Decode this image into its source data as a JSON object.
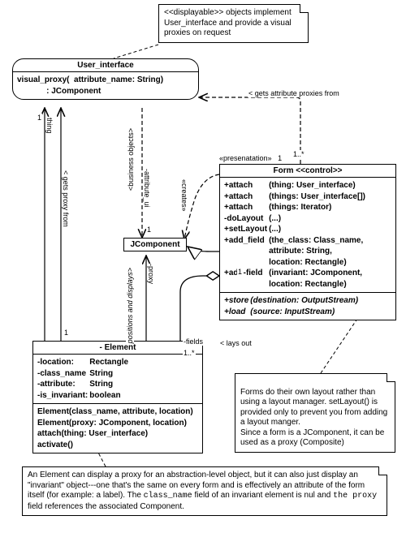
{
  "notes": {
    "top": "<<displayable>> objects implement User_interface and provide a visual proxies on request",
    "mid": "   Forms do their own layout rather than using a layout manager. setLayout() is provided only  to prevent you from adding a layout manger.\n   Since a form is a JComponent, it can be used as a proxy (Composite)",
    "bottom_p1": "An Element can display a proxy for an abstraction-level object, but it can also just display an \"invariant\" object---one that's the same on every form and is effectively an attribute of the form itself (for example: a label). The ",
    "bottom_code1": "class_name",
    "bottom_p2": " field of an invariant element is nul and ",
    "bottom_code2": "the proxy",
    "bottom_p3": " field references the associated Component."
  },
  "user_interface": {
    "title": "User_interface",
    "op": "visual_proxy(  attribute_name: String)\n             : JComponent"
  },
  "jcomponent": {
    "title": "JComponent"
  },
  "element": {
    "title": "- Element",
    "attrs": [
      {
        "n": "-location:",
        "t": "Rectangle"
      },
      {
        "n": "-class_name",
        "t": "String"
      },
      {
        "n": "-attribute:",
        "t": "String"
      },
      {
        "n": "-is_invariant:",
        "t": "boolean"
      }
    ],
    "ops": [
      "Element(class_name, attribute, location)",
      "Element(proxy: JComponent, location)",
      "attach(thing: User_interface)",
      "activate()"
    ]
  },
  "form": {
    "stereo": "«presenatation»",
    "mult": "1",
    "title": "Form <<control>>",
    "ops": [
      {
        "n": "+attach",
        "a": "(thing: User_interface)"
      },
      {
        "n": "+attach",
        "a": "(things: User_interface[])"
      },
      {
        "n": "+attach",
        "a": "(things: Iterator)"
      },
      {
        "n": "-doLayout",
        "a": "(...)"
      },
      {
        "n": "+setLayout",
        "a": "(...)"
      },
      {
        "n": "+add_field",
        "a": "(the_class: Class_name,"
      },
      {
        "n": "",
        "a": "             attribute: String,"
      },
      {
        "n": "",
        "a": "             location: Rectangle)"
      },
      {
        "n": "+add-field",
        "a": "(invariant: JComponent,"
      },
      {
        "n": "",
        "a": "             location: Rectangle)"
      }
    ],
    "ops2": [
      {
        "n": "+store",
        "a": "(destination: OutputStream)"
      },
      {
        "n": "+load",
        "a": "          (source: InputStream)"
      }
    ]
  },
  "labels": {
    "getsAttr": "< gets attribute proxies from",
    "getsAttrMult": "1..*",
    "thing": "thing",
    "one_a": "1",
    "getsProxy": "< gets proxy from",
    "one_b": "1",
    "business": "<business objects>",
    "attribute_ui": "-attribute_ui",
    "one_c": "1",
    "creates": "«creates»",
    "positions": "positions and displays>",
    "proxy": "-proxy",
    "fields": "-fields",
    "laysout": "< lays out",
    "fieldsMult": "1..*",
    "oneAgg": "1"
  },
  "chart_data": {
    "type": "diagram",
    "description": "UML class diagram",
    "classes": [
      {
        "name": "User_interface",
        "kind": "interface",
        "ops": [
          "visual_proxy(attribute_name: String): JComponent"
        ]
      },
      {
        "name": "JComponent",
        "kind": "class"
      },
      {
        "name": "Form",
        "stereotype": "control",
        "package_stereotype": "presenatation",
        "ops": [
          "+attach(thing: User_interface)",
          "+attach(things: User_interface[])",
          "+attach(things: Iterator)",
          "-doLayout(...)",
          "+setLayout(...)",
          "+add_field(the_class: Class_name, attribute: String, location: Rectangle)",
          "+add-field(invariant: JComponent, location: Rectangle)",
          "+store(destination: OutputStream)",
          "+load(source: InputStream)"
        ]
      },
      {
        "name": "Element",
        "visibility": "-",
        "attrs": [
          "-location: Rectangle",
          "-class_name String",
          "-attribute: String",
          "-is_invariant: boolean"
        ],
        "ops": [
          "Element(class_name, attribute, location)",
          "Element(proxy: JComponent, location)",
          "attach(thing: User_interface)",
          "activate()"
        ]
      }
    ],
    "relations": [
      {
        "from": "Form",
        "to": "User_interface",
        "type": "dependency",
        "label": "gets attribute proxies from",
        "mult_to": "1..*"
      },
      {
        "from": "Element",
        "to": "User_interface",
        "type": "association",
        "role_to": "thing",
        "label": "gets proxy from",
        "mult_from": "1",
        "mult_to": "1"
      },
      {
        "from": "User_interface",
        "to": "JComponent",
        "type": "dependency",
        "label": "business objects",
        "role": "attribute_ui",
        "mult_to": "1"
      },
      {
        "from": "Form",
        "to": "JComponent",
        "type": "dependency",
        "label": "creates"
      },
      {
        "from": "Element",
        "to": "JComponent",
        "type": "association",
        "label": "positions and displays",
        "role_to": "proxy"
      },
      {
        "from": "Form",
        "to": "Element",
        "type": "aggregation",
        "label": "lays out",
        "role": "fields",
        "mult_from": "1",
        "mult_to": "1..*"
      },
      {
        "from": "Form",
        "to": "JComponent",
        "type": "generalization"
      }
    ]
  }
}
